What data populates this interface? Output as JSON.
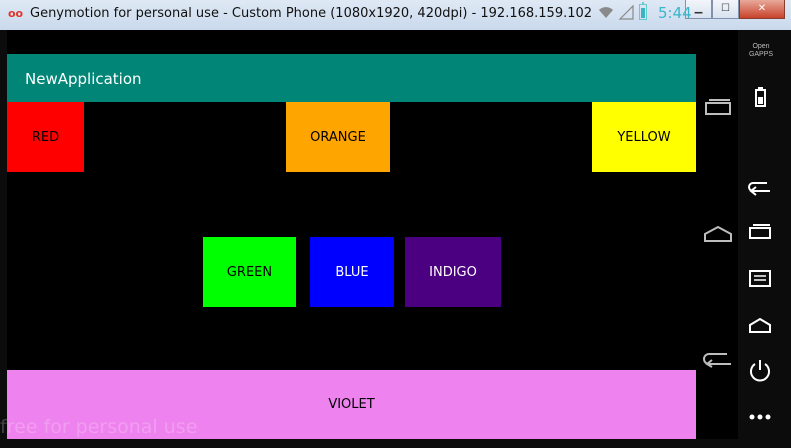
{
  "window": {
    "title": "Genymotion for personal use - Custom Phone (1080x1920, 420dpi) - 192.168.159.102",
    "logo_text": "oo",
    "controls": {
      "minimize": "▁",
      "maximize": "☐",
      "close": "✕"
    }
  },
  "status_bar": {
    "time": "5:44",
    "icons": [
      "wifi-icon",
      "signal-icon",
      "battery-charging-icon"
    ]
  },
  "app_bar": {
    "title": "NewApplication",
    "color": "#008577"
  },
  "buttons": [
    {
      "label": "RED",
      "bg": "#ff0000",
      "fg": "#000000"
    },
    {
      "label": "ORANGE",
      "bg": "#ffa500",
      "fg": "#000000"
    },
    {
      "label": "YELLOW",
      "bg": "#ffff00",
      "fg": "#000000"
    },
    {
      "label": "GREEN",
      "bg": "#00ff00",
      "fg": "#000000"
    },
    {
      "label": "BLUE",
      "bg": "#0000ff",
      "fg": "#ffffff"
    },
    {
      "label": "INDIGO",
      "bg": "#4b0082",
      "fg": "#ffffff"
    },
    {
      "label": "VIOLET",
      "bg": "#ee82ee",
      "fg": "#000000"
    }
  ],
  "watermark": "free for personal use",
  "nav_bar": {
    "icons": [
      "recents-icon",
      "home-icon",
      "back-icon"
    ]
  },
  "side_toolbar": {
    "opengapps_label": "Open GAPPS",
    "tools": [
      "battery-icon",
      "back-icon",
      "recents-icon",
      "menu-icon",
      "home-icon",
      "power-icon",
      "more-icon"
    ]
  }
}
